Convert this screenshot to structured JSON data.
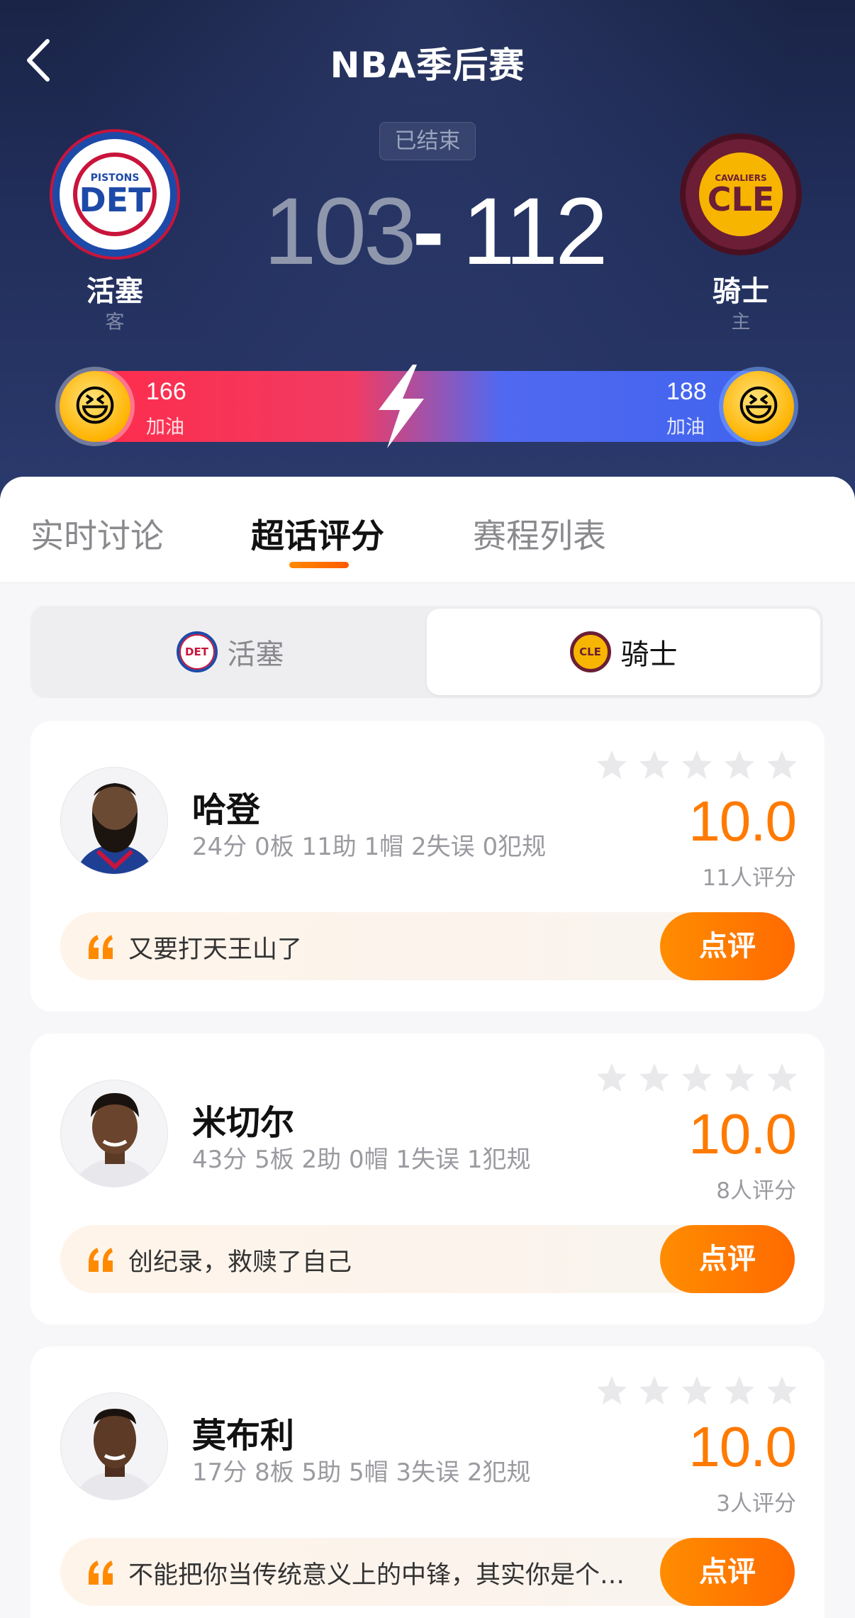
{
  "header": {
    "title": "NBA季后赛",
    "status": "已结束"
  },
  "away_team": {
    "name": "活塞",
    "role": "客",
    "logo_top": "PISTONS",
    "logo_abbr": "DET",
    "score": "103",
    "cheer_count": "166",
    "cheer_label": "加油"
  },
  "home_team": {
    "name": "骑士",
    "role": "主",
    "logo_top": "CAVALIERS",
    "logo_abbr": "CLE",
    "score": "112",
    "cheer_count": "188",
    "cheer_label": "加油"
  },
  "score_separator": "-",
  "tabs": [
    {
      "label": "实时讨论"
    },
    {
      "label": "超话评分"
    },
    {
      "label": "赛程列表"
    }
  ],
  "team_toggle": {
    "left": "活塞",
    "right": "骑士"
  },
  "players": [
    {
      "name": "哈登",
      "stats": "24分 0板 11助 1帽 2失误 0犯规",
      "rating": "10.0",
      "rating_count": "11人评分",
      "comment": "又要打天王山了",
      "review_label": "点评"
    },
    {
      "name": "米切尔",
      "stats": "43分 5板 2助 0帽 1失误 1犯规",
      "rating": "10.0",
      "rating_count": "8人评分",
      "comment": "创纪录，救赎了自己",
      "review_label": "点评"
    },
    {
      "name": "莫布利",
      "stats": "17分 8板 5助 5帽 3失误 2犯规",
      "rating": "10.0",
      "rating_count": "3人评分",
      "comment": "不能把你当传统意义上的中锋，其实你是个…",
      "review_label": "点评"
    }
  ],
  "colors": {
    "accent": "#ff7a00",
    "away_cheer": "#ff2b4a",
    "home_cheer": "#3f63ee",
    "header_bg": "#222f5c"
  },
  "icons": {
    "back": "chevron-left-icon",
    "cheer_emoji": "excited-face-icon",
    "vs": "lightning-icon",
    "star": "star-icon",
    "quote": "quote-icon"
  }
}
